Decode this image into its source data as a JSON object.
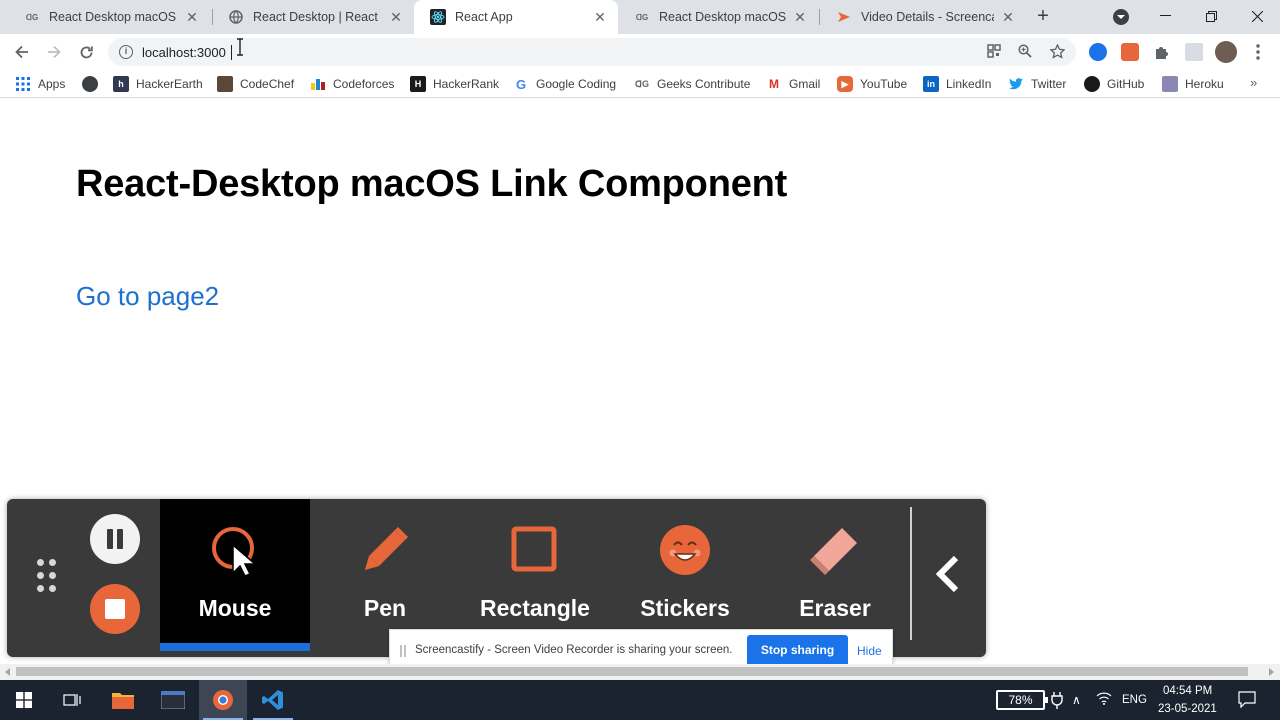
{
  "browser": {
    "tabs": [
      {
        "title": "React Desktop macOS Link",
        "favicon": "gfg-icon",
        "active": false
      },
      {
        "title": "React Desktop | React UI C",
        "favicon": "globe-icon",
        "active": false
      },
      {
        "title": "React App",
        "favicon": "react-icon",
        "active": true
      },
      {
        "title": "React Desktop macOS But",
        "favicon": "gfg-icon",
        "active": false
      },
      {
        "title": "Video Details - Screencast",
        "favicon": "screencastify-icon",
        "active": false
      }
    ],
    "address": {
      "url": "localhost:3000"
    },
    "bookmarks": [
      {
        "label": "Apps",
        "icon": "apps-grid-icon"
      },
      {
        "label": "",
        "icon": "globe-icon"
      },
      {
        "label": "HackerEarth",
        "icon": "hackerearth-icon"
      },
      {
        "label": "CodeChef",
        "icon": "codechef-icon"
      },
      {
        "label": "Codeforces",
        "icon": "codeforces-icon"
      },
      {
        "label": "HackerRank",
        "icon": "hackerrank-icon"
      },
      {
        "label": "Google Coding",
        "icon": "google-icon"
      },
      {
        "label": "Geeks Contribute",
        "icon": "gfg-icon"
      },
      {
        "label": "Gmail",
        "icon": "gmail-icon"
      },
      {
        "label": "YouTube",
        "icon": "youtube-icon"
      },
      {
        "label": "LinkedIn",
        "icon": "linkedin-icon"
      },
      {
        "label": "Twitter",
        "icon": "twitter-icon"
      },
      {
        "label": "GitHub",
        "icon": "github-icon"
      },
      {
        "label": "Heroku",
        "icon": "heroku-icon"
      }
    ],
    "more_bookmarks": "»"
  },
  "page": {
    "heading": "React-Desktop macOS Link Component",
    "link_text": "Go to page2"
  },
  "screencastify": {
    "tools": [
      {
        "label": "Mouse",
        "icon": "mouse-pointer-icon",
        "active": true
      },
      {
        "label": "Pen",
        "icon": "pen-icon",
        "active": false
      },
      {
        "label": "Rectangle",
        "icon": "rectangle-icon",
        "active": false
      },
      {
        "label": "Stickers",
        "icon": "smiley-sticker-icon",
        "active": false
      },
      {
        "label": "Eraser",
        "icon": "eraser-icon",
        "active": false
      }
    ],
    "share_message": "Screencastify - Screen Video Recorder is sharing your screen.",
    "stop_sharing_label": "Stop sharing",
    "hide_label": "Hide"
  },
  "taskbar": {
    "battery": "78%",
    "language": "ENG",
    "time": "04:54 PM",
    "date": "23-05-2021"
  },
  "colors": {
    "link": "#1e70d0",
    "accent_blue": "#1a73e8",
    "tool_orange": "#e8673a",
    "overlay_bg": "#3a3a3a",
    "taskbar_bg": "#1c2330"
  }
}
